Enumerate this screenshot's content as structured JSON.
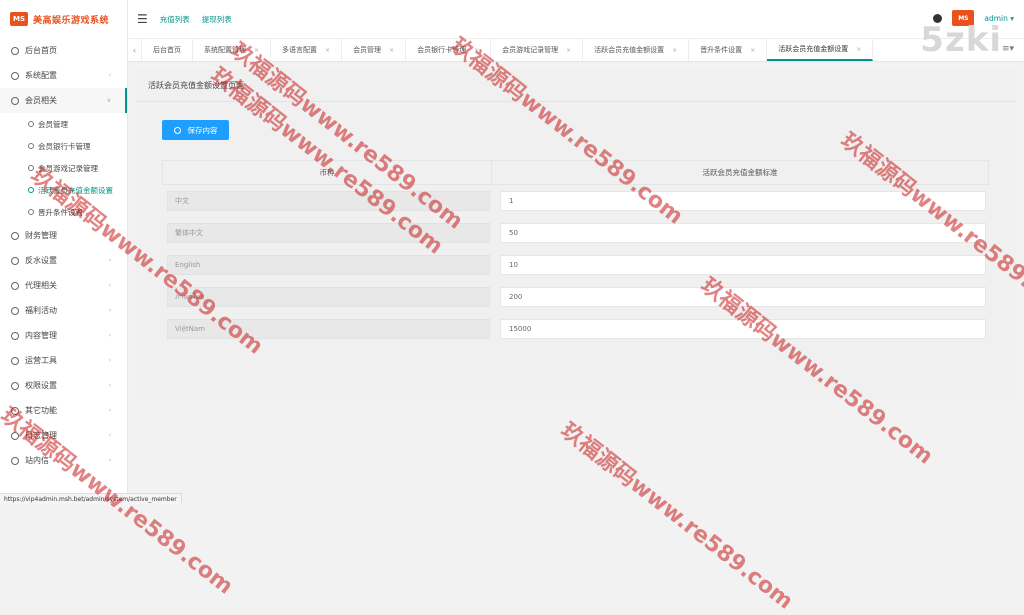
{
  "app": {
    "logo_badge": "MS",
    "title": "美高娱乐游戏系统"
  },
  "topbar": {
    "links": [
      "充值列表",
      "提现列表"
    ],
    "user": "admin",
    "avatar_badge": "MS"
  },
  "brand_mark": "5zki",
  "sidebar": {
    "items": [
      {
        "label": "后台首页",
        "arrow": false
      },
      {
        "label": "系统配置",
        "arrow": true
      },
      {
        "label": "会员相关",
        "arrow": true,
        "open": true
      },
      {
        "label": "财务管理",
        "arrow": true
      },
      {
        "label": "反水设置",
        "arrow": true
      },
      {
        "label": "代理相关",
        "arrow": true
      },
      {
        "label": "福利活动",
        "arrow": true
      },
      {
        "label": "内容管理",
        "arrow": true
      },
      {
        "label": "运营工具",
        "arrow": true
      },
      {
        "label": "权限设置",
        "arrow": true
      },
      {
        "label": "其它功能",
        "arrow": true
      },
      {
        "label": "日志管理",
        "arrow": true
      },
      {
        "label": "站内信",
        "arrow": true
      }
    ],
    "sub_items": [
      "会员管理",
      "会员银行卡管理",
      "会员游戏记录管理",
      "活跃会员充值金额设置",
      "晋升条件设置"
    ]
  },
  "tabs": [
    "后台首页",
    "系统配置管理",
    "多语言配置",
    "会员管理",
    "会员银行卡管理",
    "会员游戏记录管理",
    "活跃会员充值金额设置",
    "晋升条件设置",
    "活跃会员充值金额设置"
  ],
  "panel": {
    "title": "活跃会员充值金额设置页面",
    "save_label": "保存内容",
    "headers": [
      "币种",
      "活跃会员充值金额标准"
    ],
    "rows": [
      {
        "lang": "中文",
        "value": "1"
      },
      {
        "lang": "繁体中文",
        "value": "50"
      },
      {
        "lang": "English",
        "value": "10"
      },
      {
        "lang": "ภาษาไทย",
        "value": "200"
      },
      {
        "lang": "ViệtNam",
        "value": "15000"
      }
    ]
  },
  "statusbar": "https://vip4admin.msh.bet/admin/system/active_member",
  "watermark": {
    "zh": "玖福源码",
    "url": "www.re589.com"
  }
}
